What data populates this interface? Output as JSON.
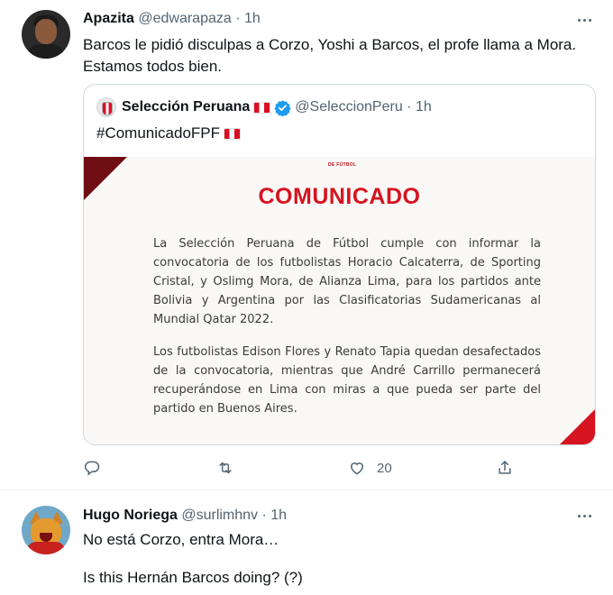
{
  "tweet1": {
    "author_name": "Apazita",
    "handle": "@edwarapaza",
    "separator": "·",
    "time": "1h",
    "text_line1": "Barcos le pidió disculpas a Corzo, Yoshi a Barcos, el profe llama a Mora.",
    "text_line2": "Estamos todos bien.",
    "quote": {
      "author_name": "Selección Peruana",
      "handle": "@SeleccionPeru",
      "separator": "·",
      "time": "1h",
      "text": "#ComunicadoFPF",
      "image": {
        "tag": "DE FÚTBOL",
        "title": "COMUNICADO",
        "paragraph1": "La Selección Peruana de Fútbol cumple con informar la convocatoria de los futbolistas Horacio Calcaterra, de Sporting Cristal, y Oslimg Mora, de Alianza Lima, para los partidos ante Bolivia y Argentina por las Clasificatorias Sudamericanas al Mundial Qatar 2022.",
        "paragraph2": "Los futbolistas Edison Flores y Renato Tapia quedan desafectados de la convocatoria, mientras que André Carrillo permanecerá recuperándose en Lima con miras a que pueda ser parte del partido en Buenos Aires."
      }
    },
    "actions": {
      "reply_icon": "reply-icon",
      "retweet_icon": "retweet-icon",
      "like_icon": "heart-icon",
      "like_count": "20",
      "share_icon": "share-icon"
    }
  },
  "tweet2": {
    "author_name": "Hugo Noriega",
    "handle": "@surlimhnv",
    "separator": "·",
    "time": "1h",
    "text_line1": "No está Corzo, entra Mora…",
    "text_line2": "Is this Hernán Barcos doing? (?)"
  },
  "colors": {
    "text": "#0f1419",
    "muted": "#536471",
    "border": "#cfd9de",
    "verified": "#1d9bf0",
    "comunicado_red": "#d6141f"
  }
}
